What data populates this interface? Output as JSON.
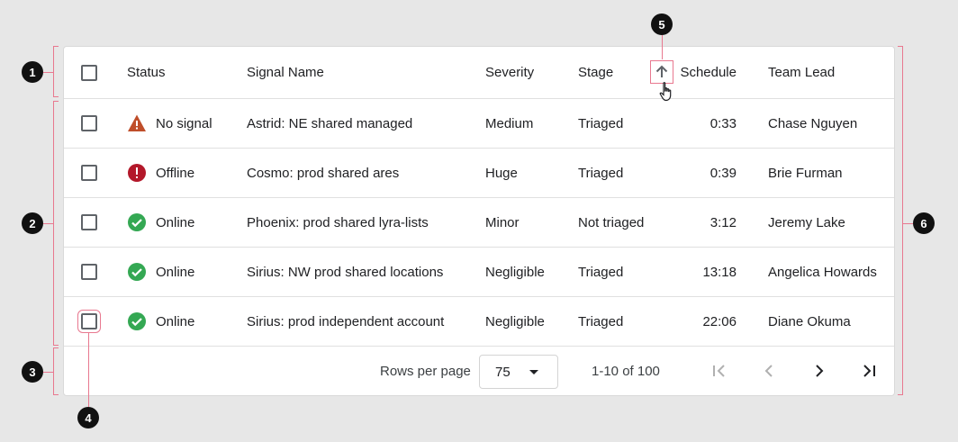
{
  "columns": {
    "status": "Status",
    "signal_name": "Signal Name",
    "severity": "Severity",
    "stage": "Stage",
    "schedule": "Schedule",
    "team_lead": "Team Lead"
  },
  "rows": [
    {
      "status": "No signal",
      "status_icon": "warning-icon",
      "signal_name": "Astrid: NE shared managed",
      "severity": "Medium",
      "stage": "Triaged",
      "schedule": "0:33",
      "team_lead": "Chase Nguyen"
    },
    {
      "status": "Offline",
      "status_icon": "error-icon",
      "signal_name": "Cosmo: prod shared ares",
      "severity": "Huge",
      "stage": "Triaged",
      "schedule": "0:39",
      "team_lead": "Brie Furman"
    },
    {
      "status": "Online",
      "status_icon": "check-circle-icon",
      "signal_name": "Phoenix: prod shared lyra-lists",
      "severity": "Minor",
      "stage": "Not triaged",
      "schedule": "3:12",
      "team_lead": "Jeremy Lake"
    },
    {
      "status": "Online",
      "status_icon": "check-circle-icon",
      "signal_name": "Sirius: NW prod shared locations",
      "severity": "Negligible",
      "stage": "Triaged",
      "schedule": "13:18",
      "team_lead": "Angelica Howards"
    },
    {
      "status": "Online",
      "status_icon": "check-circle-icon",
      "signal_name": "Sirius: prod independent account",
      "severity": "Negligible",
      "stage": "Triaged",
      "schedule": "22:06",
      "team_lead": "Diane Okuma"
    }
  ],
  "footer": {
    "rows_per_page_label": "Rows per page",
    "rows_per_page_value": "75",
    "range": "1-10 of 100"
  },
  "callouts": [
    "1",
    "2",
    "3",
    "4",
    "5",
    "6"
  ],
  "colors": {
    "warning": "#bf4e2a",
    "error": "#b3182a",
    "success": "#34a853",
    "annotation": "#e8788f"
  }
}
